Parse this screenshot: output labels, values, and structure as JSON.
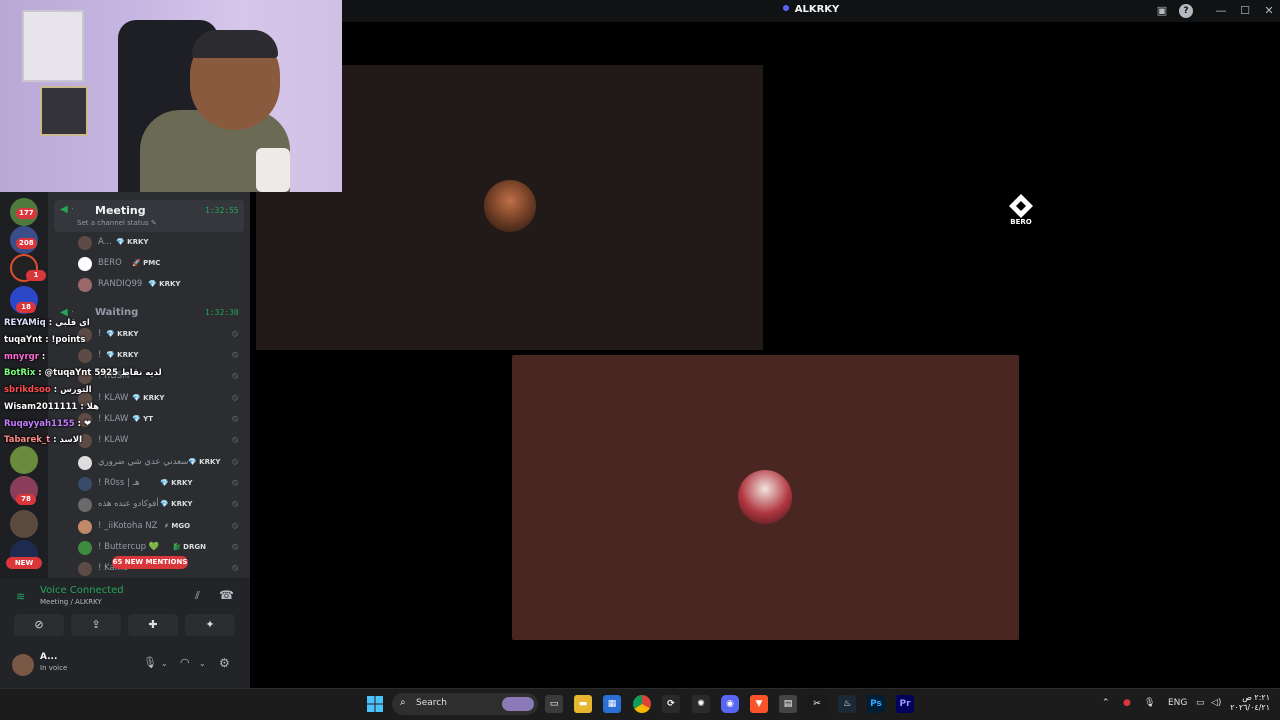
{
  "window": {
    "title": "ALKRKY"
  },
  "servers": {
    "badges": [
      "177",
      "208",
      "1",
      "18",
      "78"
    ],
    "new_label": "NEW"
  },
  "channel_list": {
    "meeting": {
      "name": "Meeting",
      "time": "1:32:55",
      "status": "Set a channel status ✎",
      "members": [
        {
          "name": "A...",
          "tag": "💎 KRKY"
        },
        {
          "name": "BERO",
          "tag": "🚀 PMC"
        },
        {
          "name": "RANDIQ99",
          "tag": "💎 KRKY"
        }
      ]
    },
    "waiting": {
      "name": "Waiting",
      "time": "1:32:30",
      "members": [
        {
          "name": "!",
          "tag": "💎 KRKY"
        },
        {
          "name": "!",
          "tag": "💎 KRKY"
        },
        {
          "name": "! RGSM",
          "tag": ""
        },
        {
          "name": "! KLAW",
          "tag": "💎 KRKY"
        },
        {
          "name": "! KLAW",
          "tag": "💎 YT"
        },
        {
          "name": "! KLAW",
          "tag": ""
        },
        {
          "name": "سعدني عدي شي ضروري",
          "tag": "💎 KRKY"
        },
        {
          "name": "! R0ss | ‏هـ",
          "tag": "💎 KRKY"
        },
        {
          "name": "أفوكادو عنده هذه !",
          "tag": "💎 KRKY"
        },
        {
          "name": "! _iiKotoha NZ",
          "tag": "⚡ MGO"
        },
        {
          "name": "! Buttercup 💚",
          "tag": "🐉 DRGN"
        },
        {
          "name": "! Kamo",
          "tag": ""
        }
      ]
    },
    "new_mentions": "65 NEW MENTIONS"
  },
  "chat_overlay": [
    {
      "user": "REYAMiq",
      "msg": ": ای قلبي",
      "color": "#e0e0ff"
    },
    {
      "user": "tuqaYnt",
      "msg": ": !points",
      "color": "#ffffff"
    },
    {
      "user": "mnyrgr",
      "msg": ":",
      "color": "#ff6ad5"
    },
    {
      "user": "BotRix",
      "msg": ": @tuqaYnt لديه نقاط 5925",
      "color": "#7cff7c"
    },
    {
      "user": "sbrikdsoo",
      "msg": ": التورس",
      "color": "#ff4d4d"
    },
    {
      "user": "Wisam2011111",
      "msg": ": هلا",
      "color": "#ffffff"
    },
    {
      "user": "Ruqayyah1155",
      "msg": ": ❤",
      "color": "#c77dff"
    },
    {
      "user": "Tabarek_t",
      "msg": ": الاسد",
      "color": "#ff8a8a"
    }
  ],
  "voice_panel": {
    "connected": "Voice Connected",
    "location": "Meeting / ALKRKY",
    "user_name": "A...",
    "user_status": "In voice"
  },
  "stage": {
    "bero_label": "BERO"
  },
  "taskbar": {
    "search_placeholder": "Search",
    "lang": "ENG",
    "time": "٢:٢١ ص",
    "date": "٢٠٢٦/٠٤/٢١"
  },
  "colors": {
    "discord_dark": "#2b2d31",
    "voice_green": "#23a55a",
    "mention_red": "#da373c",
    "tile_red": "#4a2623"
  }
}
